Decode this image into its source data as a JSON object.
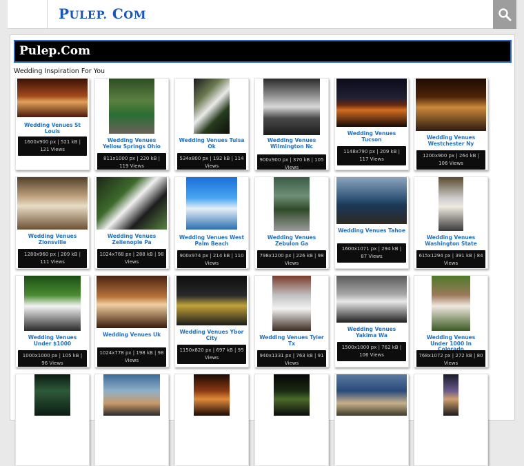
{
  "header": {
    "logo_main": "P",
    "logo_rest1": "ULEP.",
    "logo_c": " C",
    "logo_rest2": "OM",
    "search_icon": "search-icon",
    "accent": "#1755c7"
  },
  "banner": {
    "title": "Pulep.Com"
  },
  "section": {
    "subtitle": "Wedding Inspiration For You"
  },
  "cards": [
    {
      "title": "Wedding Venues St Louis",
      "meta": "1600x900 px | 521 kB | 121 Views"
    },
    {
      "title": "Wedding Venues Yellow Springs Ohio",
      "meta": "811x1000 px | 220 kB | 119 Views"
    },
    {
      "title": "Wedding Venues Tulsa Ok",
      "meta": "534x800 px | 192 kB | 114 Views"
    },
    {
      "title": "Wedding Venues Wilmington Nc",
      "meta": "900x900 px | 370 kB | 105 Views"
    },
    {
      "title": "Wedding Venues Tucson",
      "meta": "1148x790 px | 209 kB | 117 Views"
    },
    {
      "title": "Wedding Venues Westchester Ny",
      "meta": "1200x900 px | 264 kB | 106 Views"
    },
    {
      "title": "Wedding Venues Zionsville",
      "meta": "1280x960 px | 209 kB | 111 Views"
    },
    {
      "title": "Wedding Venues Zelienople Pa",
      "meta": "1024x768 px | 288 kB | 98 Views"
    },
    {
      "title": "Wedding Venues West Palm Beach",
      "meta": "900x974 px | 214 kB | 110 Views"
    },
    {
      "title": "Wedding Venues Zebulon Ga",
      "meta": "798x1200 px | 226 kB | 98 Views"
    },
    {
      "title": "Wedding Venues Tahoe",
      "meta": "1600x1071 px | 294 kB | 87 Views"
    },
    {
      "title": "Wedding Venues Washington State",
      "meta": "615x1294 px | 391 kB | 84 Views"
    },
    {
      "title": "Wedding Venues Under $1000",
      "meta": "1000x1000 px | 105 kB | 96 Views"
    },
    {
      "title": "Wedding Venues Uk",
      "meta": "1024x778 px | 198 kB | 98 Views"
    },
    {
      "title": "Wedding Venues Ybor City",
      "meta": "1150x820 px | 697 kB | 95 Views"
    },
    {
      "title": "Wedding Venues Tyler Tx",
      "meta": "940x1331 px | 763 kB | 91 Views"
    },
    {
      "title": "Wedding Venues Yakima Wa",
      "meta": "1500x1000 px | 762 kB | 106 Views"
    },
    {
      "title": "Wedding Venues Under 1000 In Colorado",
      "meta": "768x1072 px | 272 kB | 80 Views"
    },
    {
      "title": "",
      "meta": ""
    },
    {
      "title": "",
      "meta": ""
    },
    {
      "title": "",
      "meta": ""
    },
    {
      "title": "",
      "meta": ""
    },
    {
      "title": "",
      "meta": ""
    },
    {
      "title": "",
      "meta": ""
    }
  ]
}
